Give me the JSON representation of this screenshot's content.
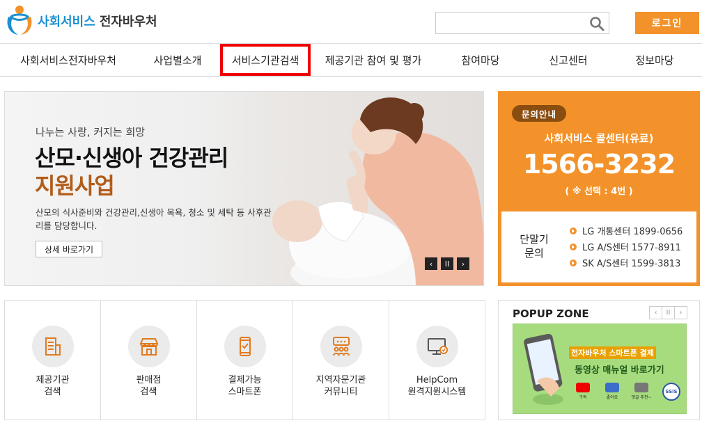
{
  "header": {
    "logo_blue": "사회서비스",
    "logo_dark": "전자바우처",
    "search_placeholder": "",
    "login_label": "로그인"
  },
  "nav": {
    "items": [
      {
        "label": "사회서비스전자바우처"
      },
      {
        "label": "사업별소개"
      },
      {
        "label": "서비스기관검색",
        "active": true
      },
      {
        "label": "제공기관 참여 및 평가"
      },
      {
        "label": "참여마당"
      },
      {
        "label": "신고센터"
      },
      {
        "label": "정보마당"
      }
    ]
  },
  "hero": {
    "subtitle": "나누는 사랑, 커지는 희망",
    "title1": "산모·신생아 건강관리",
    "title2": "지원사업",
    "desc": "산모의 식사준비와 건강관리,신생아 목욕, 청소 및 세탁 등 사후관리를 담당합니다.",
    "button": "상세 바로가기",
    "ctrl_prev": "‹",
    "ctrl_pause": "II",
    "ctrl_next": "›"
  },
  "contact": {
    "badge": "문의안내",
    "name": "사회서비스 콜센터(유료)",
    "number": "1566-3232",
    "option": "( ※ 선택 : 4번 )",
    "box_label": "단말기\n문의",
    "lines": [
      "LG 개통센터 1899-0656",
      "LG A/S센터 1577-8911",
      "SK A/S센터 1599-3813"
    ]
  },
  "quick": [
    {
      "label": "제공기관\n검색",
      "icon": "building-icon"
    },
    {
      "label": "판매점\n검색",
      "icon": "store-icon"
    },
    {
      "label": "결제가능\n스마트폰",
      "icon": "smartphone-icon"
    },
    {
      "label": "지역자문기관\n커뮤니티",
      "icon": "community-icon"
    },
    {
      "label": "HelpCom\n원격지원시스템",
      "icon": "monitor-icon"
    }
  ],
  "popup": {
    "title": "POPUP ZONE",
    "ctrl_prev": "‹",
    "ctrl_pause": "II",
    "ctrl_next": "›",
    "banner_line1": "전자바우처 스마트폰 결제",
    "banner_line2": "동영상 매뉴얼 바로가기",
    "banner_icons": [
      "구독",
      "좋아요",
      "댓글 추천~"
    ],
    "banner_logo": "SSiS"
  },
  "colors": {
    "accent": "#f3922a",
    "brand_blue": "#1a8fd1",
    "hero_title2": "#b25c1a",
    "highlight": "#e00000"
  }
}
